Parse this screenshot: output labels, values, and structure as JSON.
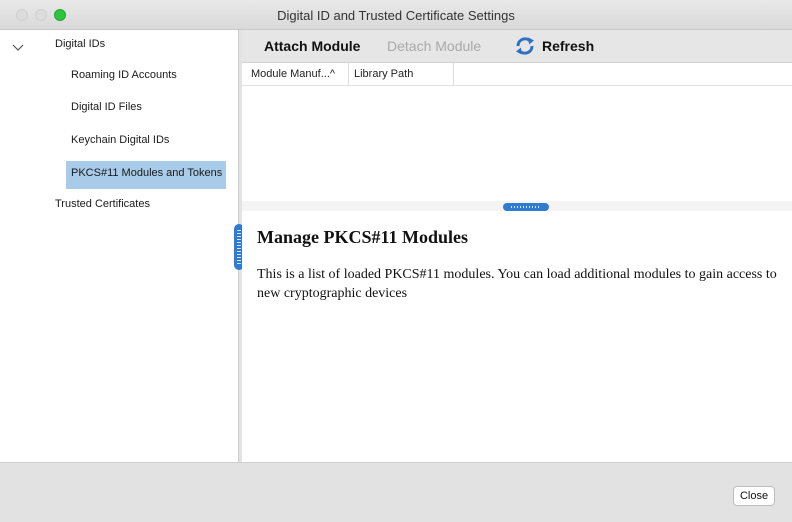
{
  "window": {
    "title": "Digital ID and Trusted Certificate Settings"
  },
  "sidebar": {
    "root_label": "Digital IDs",
    "children": [
      {
        "label": "Roaming ID Accounts"
      },
      {
        "label": "Digital ID Files"
      },
      {
        "label": "Keychain Digital IDs"
      },
      {
        "label": "PKCS#11 Modules and Tokens",
        "selected": true
      }
    ],
    "trusted_label": "Trusted Certificates"
  },
  "toolbar": {
    "attach_label": "Attach Module",
    "detach_label": "Detach Module",
    "refresh_label": "Refresh",
    "refresh_icon": "refresh-icon"
  },
  "table": {
    "columns": [
      {
        "label": "Module Manuf...^"
      },
      {
        "label": "Library Path"
      }
    ],
    "rows": []
  },
  "description": {
    "title": "Manage PKCS#11 Modules",
    "text": "This is a list of loaded PKCS#11 modules. You can load additional modules to gain access to new cryptographic devices"
  },
  "footer": {
    "close_label": "Close"
  },
  "colors": {
    "selection": "#a7cbe8",
    "accent": "#2f7bd3",
    "maximize": "#2ec43f"
  }
}
